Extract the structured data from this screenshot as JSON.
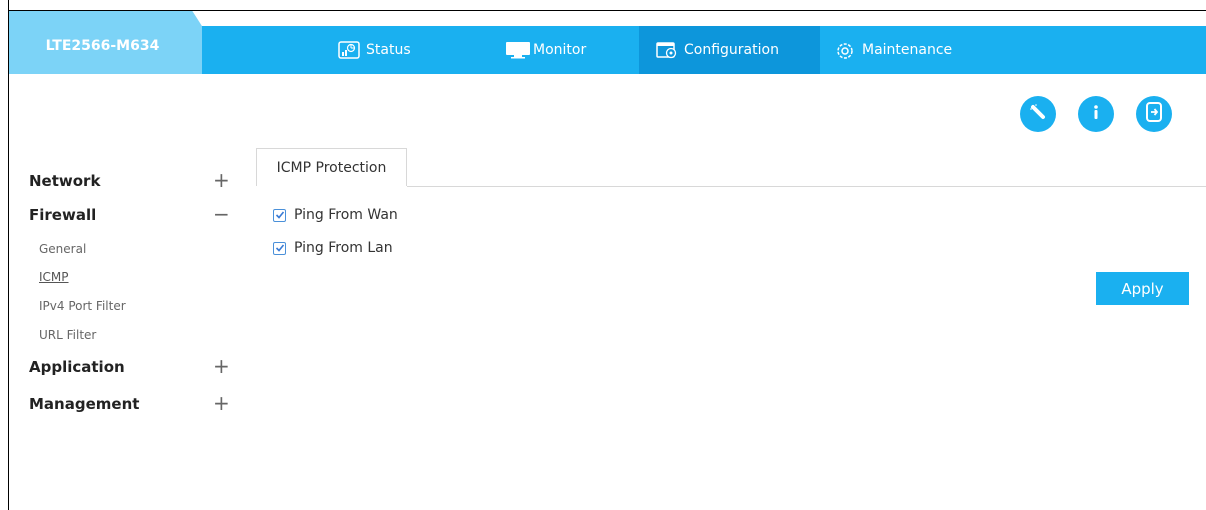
{
  "header": {
    "model_name": "LTE2566-M634",
    "nav": [
      {
        "label": "Status",
        "icon": "status-icon"
      },
      {
        "label": "Monitor",
        "icon": "monitor-icon"
      },
      {
        "label": "Configuration",
        "icon": "configuration-icon",
        "active": true
      },
      {
        "label": "Maintenance",
        "icon": "maintenance-icon"
      }
    ]
  },
  "toolbar": {
    "buttons": [
      "wizard-icon",
      "info-icon",
      "logout-icon"
    ]
  },
  "sidebar": {
    "groups": [
      {
        "label": "Network",
        "toggle": "+"
      },
      {
        "label": "Firewall",
        "toggle": "−",
        "expanded": true,
        "items": [
          "General",
          "ICMP",
          "IPv4 Port Filter",
          "URL Filter"
        ],
        "active_item": "ICMP"
      },
      {
        "label": "Application",
        "toggle": "+"
      },
      {
        "label": "Management",
        "toggle": "+"
      }
    ]
  },
  "main": {
    "tab": "ICMP Protection",
    "options": [
      {
        "label": "Ping From Wan",
        "checked": true
      },
      {
        "label": "Ping From Lan",
        "checked": true
      }
    ],
    "apply_label": "Apply"
  },
  "colors": {
    "accent": "#1ab0f0",
    "accent_dark": "#0d96db",
    "model_tab": "#7cd3f7"
  }
}
